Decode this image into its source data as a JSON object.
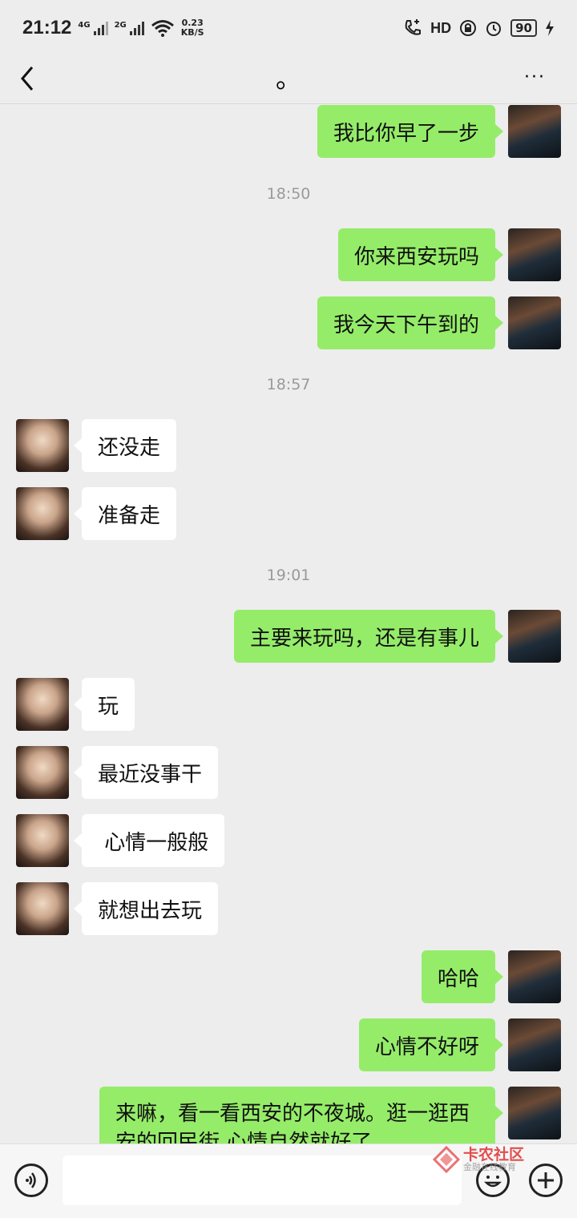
{
  "status_bar": {
    "time": "21:12",
    "signal1": "4G",
    "signal2": "2G",
    "net_speed_value": "0.23",
    "net_speed_unit": "KB/S",
    "hd_label": "HD",
    "battery": "90",
    "icons": [
      "wifi-icon",
      "call-icon",
      "hd-icon",
      "lock-icon",
      "alarm-icon",
      "battery-icon",
      "charging-icon"
    ]
  },
  "nav": {
    "title": "。",
    "more": "···"
  },
  "messages": [
    {
      "side": "right",
      "text": "我比你早了一步"
    },
    {
      "time": "18:50"
    },
    {
      "side": "right",
      "text": "你来西安玩吗"
    },
    {
      "side": "right",
      "text": "我今天下午到的"
    },
    {
      "time": "18:57"
    },
    {
      "side": "left",
      "text": "还没走"
    },
    {
      "side": "left",
      "text": "准备走"
    },
    {
      "time": "19:01"
    },
    {
      "side": "right",
      "text": "主要来玩吗，还是有事儿"
    },
    {
      "side": "left",
      "text": "玩"
    },
    {
      "side": "left",
      "text": "最近没事干"
    },
    {
      "side": "left",
      "text": " 心情一般般"
    },
    {
      "side": "left",
      "text": "就想出去玩"
    },
    {
      "side": "right",
      "text": "哈哈"
    },
    {
      "side": "right",
      "text": "心情不好呀"
    },
    {
      "side": "right",
      "text": "来嘛，看一看西安的不夜城。逛一逛西安的回民街,心情自然就好了"
    }
  ],
  "input": {
    "placeholder": ""
  },
  "watermark": {
    "text": "卡农社区",
    "sub": "金融在线教育"
  }
}
